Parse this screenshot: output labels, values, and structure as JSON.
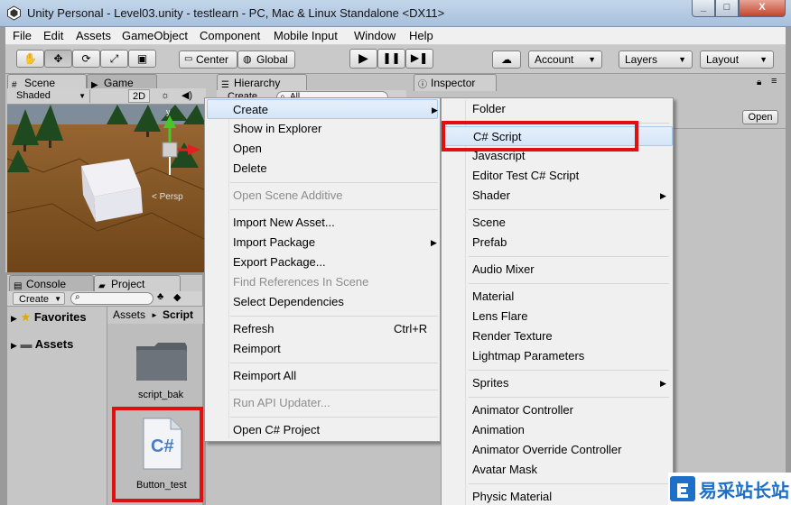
{
  "window": {
    "title": "Unity Personal - Level03.unity - testlearn - PC, Mac & Linux Standalone <DX11>",
    "controls": {
      "minimize": "_",
      "maximize": "□",
      "close": "X"
    }
  },
  "menubar": [
    "File",
    "Edit",
    "Assets",
    "GameObject",
    "Component",
    "Mobile Input",
    "Window",
    "Help"
  ],
  "toolbar": {
    "pivot_center": "Center",
    "pivot_global": "Global",
    "account": "Account",
    "layers": "Layers",
    "layout": "Layout"
  },
  "scene": {
    "tab_scene": "Scene",
    "tab_game": "Game",
    "shading": "Shaded",
    "mode_2d": "2D",
    "persp": "< Persp",
    "gizmo_y": "y"
  },
  "hierarchy": {
    "tab": "Hierarchy",
    "create": "Create",
    "search": "All"
  },
  "inspector": {
    "tab": "Inspector",
    "open_button": "Open"
  },
  "project": {
    "tab_console": "Console",
    "tab_project": "Project",
    "create": "Create",
    "favorites": "Favorites",
    "assets": "Assets",
    "breadcrumb_root": "Assets",
    "breadcrumb_sep": "►",
    "breadcrumb_current": "Script",
    "files": [
      {
        "name": "script_bak",
        "kind": "folder"
      },
      {
        "name": "Button_test",
        "kind": "csharp",
        "glyph": "C#"
      }
    ]
  },
  "context_menu": {
    "items": [
      {
        "label": "Create",
        "state": "highlighted",
        "submenu": true
      },
      {
        "label": "Show in Explorer"
      },
      {
        "label": "Open"
      },
      {
        "label": "Delete"
      },
      {
        "label": "Open Scene Additive",
        "state": "disabled"
      },
      {
        "label": "Import New Asset..."
      },
      {
        "label": "Import Package",
        "submenu": true
      },
      {
        "label": "Export Package..."
      },
      {
        "label": "Find References In Scene",
        "state": "disabled"
      },
      {
        "label": "Select Dependencies"
      },
      {
        "label": "Refresh",
        "shortcut": "Ctrl+R"
      },
      {
        "label": "Reimport"
      },
      {
        "label": "Reimport All"
      },
      {
        "label": "Run API Updater...",
        "state": "disabled"
      },
      {
        "label": "Open C# Project"
      }
    ]
  },
  "create_submenu": {
    "items": [
      {
        "label": "Folder"
      },
      {
        "label": "C# Script",
        "state": "highlighted"
      },
      {
        "label": "Javascript"
      },
      {
        "label": "Editor Test C# Script"
      },
      {
        "label": "Shader",
        "submenu": true
      },
      {
        "label": "Scene"
      },
      {
        "label": "Prefab"
      },
      {
        "label": "Audio Mixer"
      },
      {
        "label": "Material"
      },
      {
        "label": "Lens Flare"
      },
      {
        "label": "Render Texture"
      },
      {
        "label": "Lightmap Parameters"
      },
      {
        "label": "Sprites",
        "submenu": true
      },
      {
        "label": "Animator Controller"
      },
      {
        "label": "Animation"
      },
      {
        "label": "Animator Override Controller"
      },
      {
        "label": "Avatar Mask"
      },
      {
        "label": "Physic Material"
      }
    ]
  },
  "watermark": {
    "brand": "易采站长站"
  },
  "colors": {
    "highlight_box": "#e01010",
    "menu_bg": "#f0f0f0",
    "menu_highlight": "#d4e5f7"
  }
}
